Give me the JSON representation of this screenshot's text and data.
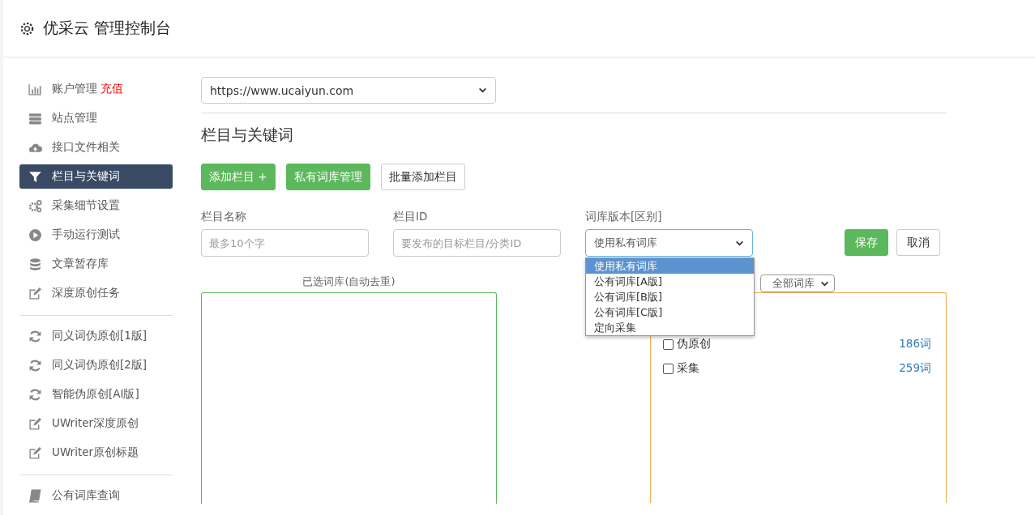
{
  "header": {
    "title": "优采云 管理控制台"
  },
  "sidebar": {
    "groups": [
      [
        {
          "label": "账户管理",
          "badge": "充值",
          "kind": "chart",
          "selected": false
        },
        {
          "label": "站点管理",
          "kind": "server",
          "selected": false
        },
        {
          "label": "接口文件相关",
          "kind": "cloud",
          "selected": false
        },
        {
          "label": "栏目与关键词",
          "kind": "filter",
          "selected": true
        },
        {
          "label": "采集细节设置",
          "kind": "gears",
          "selected": false
        },
        {
          "label": "手动运行测试",
          "kind": "play",
          "selected": false
        },
        {
          "label": "文章暂存库",
          "kind": "database",
          "selected": false
        },
        {
          "label": "深度原创任务",
          "kind": "edit",
          "selected": false
        }
      ],
      [
        {
          "label": "同义词伪原创[1版]",
          "kind": "refresh",
          "selected": false
        },
        {
          "label": "同义词伪原创[2版]",
          "kind": "refresh",
          "selected": false
        },
        {
          "label": "智能伪原创[AI版]",
          "kind": "refresh",
          "selected": false
        },
        {
          "label": "UWriter深度原创",
          "kind": "edit",
          "selected": false
        },
        {
          "label": "UWriter原创标题",
          "kind": "edit",
          "selected": false
        }
      ],
      [
        {
          "label": "公有词库查询",
          "kind": "book",
          "selected": false
        }
      ]
    ]
  },
  "site_select": {
    "value": "https://www.ucaiyun.com"
  },
  "section_title": "栏目与关键词",
  "toolbar": [
    {
      "label": "添加栏目 +",
      "kind": "primary"
    },
    {
      "label": "私有词库管理",
      "kind": "primary"
    },
    {
      "label": "批量添加栏目",
      "kind": "default"
    }
  ],
  "form": {
    "name_field": {
      "label": "栏目名称",
      "placeholder": "最多10个字"
    },
    "id_field": {
      "label": "栏目ID",
      "placeholder": "要发布的目标栏目/分类ID"
    },
    "version_select": {
      "label": "词库版本[区别]",
      "value": "使用私有词库",
      "options": [
        {
          "label": "使用私有词库",
          "selected": true
        },
        {
          "label": "公有词库[A版]",
          "selected": false
        },
        {
          "label": "公有词库[B版]",
          "selected": false
        },
        {
          "label": "公有词库[C版]",
          "selected": false
        },
        {
          "label": "定向采集",
          "selected": false
        }
      ]
    },
    "save": "保存",
    "cancel": "取消"
  },
  "selected_panel": {
    "title": "已选词库(自动去重)"
  },
  "library_panel": {
    "filter": "全部词库",
    "rows": [
      {
        "name": "伪原创",
        "count": "186词",
        "checked": false
      },
      {
        "name": "采集",
        "count": "259词",
        "checked": false
      }
    ]
  }
}
